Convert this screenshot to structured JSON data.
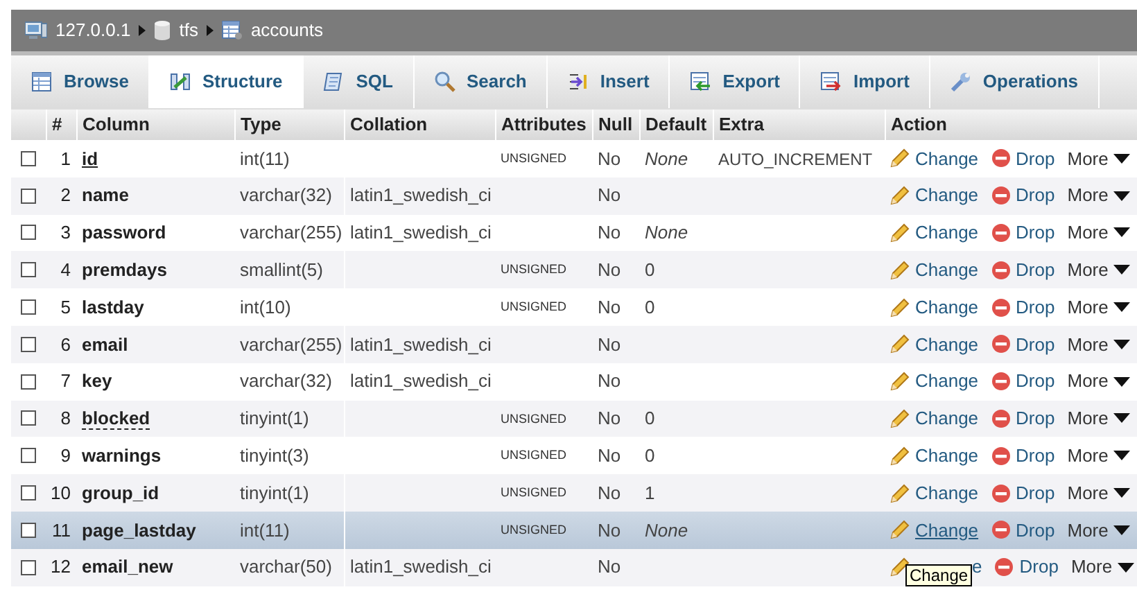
{
  "breadcrumb": [
    {
      "kind": "server",
      "label": "127.0.0.1"
    },
    {
      "kind": "database",
      "label": "tfs"
    },
    {
      "kind": "table",
      "label": "accounts"
    }
  ],
  "tabs": [
    {
      "kind": "browse",
      "label": "Browse",
      "selected": false
    },
    {
      "kind": "structure",
      "label": "Structure",
      "selected": true
    },
    {
      "kind": "sql",
      "label": "SQL",
      "selected": false
    },
    {
      "kind": "search",
      "label": "Search",
      "selected": false
    },
    {
      "kind": "insert",
      "label": "Insert",
      "selected": false
    },
    {
      "kind": "export",
      "label": "Export",
      "selected": false
    },
    {
      "kind": "import",
      "label": "Import",
      "selected": false
    },
    {
      "kind": "operations",
      "label": "Operations",
      "selected": false
    }
  ],
  "table": {
    "columns": [
      "#",
      "Column",
      "Type",
      "Collation",
      "Attributes",
      "Null",
      "Default",
      "Extra",
      "Action"
    ],
    "rows": [
      {
        "num": "1",
        "name": "id",
        "primary_key": true,
        "has_comment": false,
        "type": "int(11)",
        "attributes": "UNSIGNED",
        "null": "No",
        "default": "None",
        "default_italic": true,
        "extra": "AUTO_INCREMENT",
        "highlighted": false,
        "checked": false,
        "change": "Change",
        "drop": "Drop",
        "more": "More"
      },
      {
        "num": "2",
        "primary_key": false,
        "has_comment": false,
        "name": "name",
        "type": "varchar(32)",
        "collation": "latin1_swedish_ci",
        "null": "No",
        "highlighted": false,
        "checked": false,
        "change": "Change",
        "drop": "Drop",
        "more": "More"
      },
      {
        "num": "3",
        "primary_key": false,
        "has_comment": false,
        "name": "password",
        "type": "varchar(255)",
        "collation": "latin1_swedish_ci",
        "null": "No",
        "default": "None",
        "default_italic": true,
        "highlighted": false,
        "checked": false,
        "change": "Change",
        "drop": "Drop",
        "more": "More"
      },
      {
        "num": "4",
        "primary_key": false,
        "has_comment": false,
        "name": "premdays",
        "type": "smallint(5)",
        "attributes": "UNSIGNED",
        "null": "No",
        "default": "0",
        "default_italic": false,
        "highlighted": false,
        "checked": false,
        "change": "Change",
        "drop": "Drop",
        "more": "More"
      },
      {
        "num": "5",
        "primary_key": false,
        "has_comment": false,
        "name": "lastday",
        "type": "int(10)",
        "attributes": "UNSIGNED",
        "null": "No",
        "default": "0",
        "default_italic": false,
        "highlighted": false,
        "checked": false,
        "change": "Change",
        "drop": "Drop",
        "more": "More"
      },
      {
        "num": "6",
        "primary_key": false,
        "has_comment": false,
        "name": "email",
        "type": "varchar(255)",
        "collation": "latin1_swedish_ci",
        "null": "No",
        "highlighted": false,
        "checked": false,
        "change": "Change",
        "drop": "Drop",
        "more": "More"
      },
      {
        "num": "7",
        "primary_key": false,
        "has_comment": false,
        "name": "key",
        "type": "varchar(32)",
        "collation": "latin1_swedish_ci",
        "null": "No",
        "highlighted": false,
        "checked": false,
        "change": "Change",
        "drop": "Drop",
        "more": "More"
      },
      {
        "num": "8",
        "name": "blocked",
        "primary_key": false,
        "has_comment": true,
        "type": "tinyint(1)",
        "attributes": "UNSIGNED",
        "null": "No",
        "default": "0",
        "default_italic": false,
        "highlighted": false,
        "checked": false,
        "change": "Change",
        "drop": "Drop",
        "more": "More"
      },
      {
        "num": "9",
        "primary_key": false,
        "has_comment": false,
        "name": "warnings",
        "type": "tinyint(3)",
        "attributes": "UNSIGNED",
        "null": "No",
        "default": "0",
        "default_italic": false,
        "highlighted": false,
        "checked": false,
        "change": "Change",
        "drop": "Drop",
        "more": "More"
      },
      {
        "num": "10",
        "primary_key": false,
        "has_comment": false,
        "name": "group_id",
        "type": "tinyint(1)",
        "attributes": "UNSIGNED",
        "null": "No",
        "default": "1",
        "default_italic": false,
        "highlighted": false,
        "checked": false,
        "change": "Change",
        "drop": "Drop",
        "more": "More"
      },
      {
        "num": "11",
        "primary_key": false,
        "has_comment": false,
        "name": "page_lastday",
        "type": "int(11)",
        "attributes": "UNSIGNED",
        "null": "No",
        "default": "None",
        "default_italic": true,
        "highlighted": true,
        "checked": false,
        "change": "Change",
        "drop": "Drop",
        "more": "More"
      },
      {
        "num": "12",
        "primary_key": false,
        "has_comment": false,
        "name": "email_new",
        "type": "varchar(50)",
        "collation": "latin1_swedish_ci",
        "null": "No",
        "highlighted": false,
        "checked": false,
        "change": "e",
        "tooltip": "Change",
        "drop": "Drop",
        "more": "More"
      }
    ]
  }
}
